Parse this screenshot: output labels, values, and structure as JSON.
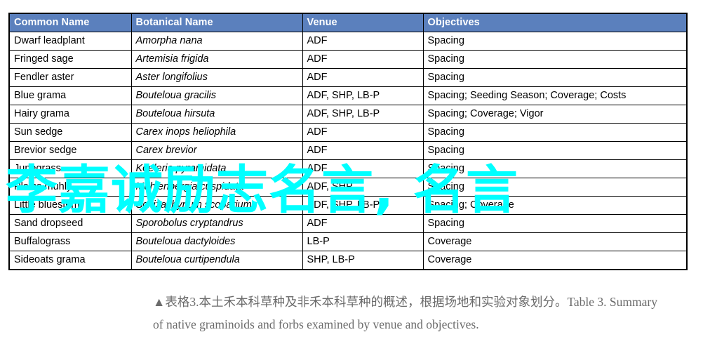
{
  "table": {
    "headers": [
      "Common Name",
      "Botanical  Name",
      "Venue",
      "Objectives"
    ],
    "header_bg": "#5b80bd",
    "header_text_color": "#ffffff",
    "rows": [
      {
        "common": "Dwarf leadplant",
        "botanical": "Amorpha nana",
        "venue": "ADF",
        "objectives": "Spacing"
      },
      {
        "common": "Fringed sage",
        "botanical": "Artemisia frigida",
        "venue": "ADF",
        "objectives": "Spacing"
      },
      {
        "common": "Fendler aster",
        "botanical": "Aster longifolius",
        "venue": "ADF",
        "objectives": "Spacing"
      },
      {
        "common": "Blue grama",
        "botanical": "Bouteloua gracilis",
        "venue": "ADF, SHP, LB-P",
        "objectives": "Spacing; Seeding Season;  Coverage; Costs"
      },
      {
        "common": "Hairy grama",
        "botanical": "Bouteloua hirsuta",
        "venue": "ADF, SHP, LB-P",
        "objectives": "Spacing; Coverage; Vigor"
      },
      {
        "common": "Sun sedge",
        "botanical": "Carex inops heliophila",
        "venue": "ADF",
        "objectives": "Spacing"
      },
      {
        "common": "Brevior sedge",
        "botanical": "Carex brevior",
        "venue": "ADF",
        "objectives": "Spacing"
      },
      {
        "common": "Junegrass",
        "botanical": "Koeleria pyramidata",
        "venue": "ADF",
        "objectives": "Spacing"
      },
      {
        "common": "Plains muhly",
        "botanical": "Muhlenbergia cuspidata",
        "venue": "ADF, SHP",
        "objectives": "Spacing"
      },
      {
        "common": "Little bluestem",
        "botanical": "Schizachyrium scoparium",
        "venue": "ADF, SHP, LB-P",
        "objectives": "Spacing; Coverage"
      },
      {
        "common": "Sand dropseed",
        "botanical": "Sporobolus cryptandrus",
        "venue": "ADF",
        "objectives": "Spacing"
      },
      {
        "common": "Buffalograss",
        "botanical": "Bouteloua dactyloides",
        "venue": "LB-P",
        "objectives": "Coverage"
      },
      {
        "common": "Sideoats grama",
        "botanical": "Bouteloua curtipendula",
        "venue": "SHP, LB-P",
        "objectives": "Coverage"
      }
    ]
  },
  "watermark": {
    "text": "李嘉诚励志名言, 名言",
    "color": "#00ffff"
  },
  "caption": {
    "line1": "▲表格3.本土禾本科草种及非禾本科草种的概述，根据场地和实验对象划分。Table 3. Summary",
    "line2": "of native graminoids and forbs examined by venue and objectives."
  }
}
